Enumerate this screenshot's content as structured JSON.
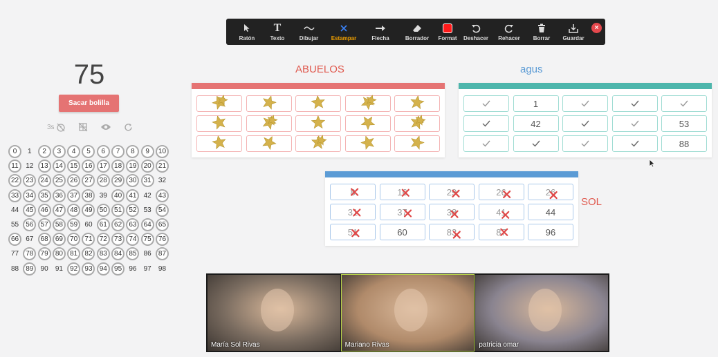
{
  "toolbar": {
    "tools": [
      {
        "label": "Ratón",
        "icon": "mouse-pointer-icon"
      },
      {
        "label": "Texto",
        "icon": "text-icon"
      },
      {
        "label": "Dibujar",
        "icon": "draw-squiggle-icon"
      },
      {
        "label": "Estampar",
        "icon": "stamp-x-icon",
        "active": true
      },
      {
        "label": "Flecha",
        "icon": "arrow-icon"
      },
      {
        "label": "Borrador",
        "icon": "eraser-icon"
      },
      {
        "label": "Format",
        "icon": "color-swatch-icon"
      },
      {
        "label": "Deshacer",
        "icon": "undo-icon"
      },
      {
        "label": "Rehacer",
        "icon": "redo-icon"
      },
      {
        "label": "Borrar",
        "icon": "trash-icon"
      },
      {
        "label": "Guardar",
        "icon": "save-icon"
      }
    ],
    "close_symbol": "×"
  },
  "bingo": {
    "current_number": "75",
    "draw_button": "Sacar bolilla",
    "timer_label": "3s",
    "numbers": [
      {
        "n": "0",
        "c": true
      },
      {
        "n": "1",
        "c": false
      },
      {
        "n": "2",
        "c": true
      },
      {
        "n": "3",
        "c": true
      },
      {
        "n": "4",
        "c": true
      },
      {
        "n": "5",
        "c": true
      },
      {
        "n": "6",
        "c": true
      },
      {
        "n": "7",
        "c": true
      },
      {
        "n": "8",
        "c": true
      },
      {
        "n": "9",
        "c": true
      },
      {
        "n": "10",
        "c": true
      },
      {
        "n": "11",
        "c": true
      },
      {
        "n": "12",
        "c": false
      },
      {
        "n": "13",
        "c": true
      },
      {
        "n": "14",
        "c": true
      },
      {
        "n": "15",
        "c": true
      },
      {
        "n": "16",
        "c": true
      },
      {
        "n": "17",
        "c": true
      },
      {
        "n": "18",
        "c": true
      },
      {
        "n": "19",
        "c": true
      },
      {
        "n": "20",
        "c": true
      },
      {
        "n": "21",
        "c": true
      },
      {
        "n": "22",
        "c": true
      },
      {
        "n": "23",
        "c": true
      },
      {
        "n": "24",
        "c": true
      },
      {
        "n": "25",
        "c": true
      },
      {
        "n": "26",
        "c": true
      },
      {
        "n": "27",
        "c": true
      },
      {
        "n": "28",
        "c": true
      },
      {
        "n": "29",
        "c": true
      },
      {
        "n": "30",
        "c": true
      },
      {
        "n": "31",
        "c": true
      },
      {
        "n": "32",
        "c": false
      },
      {
        "n": "33",
        "c": true
      },
      {
        "n": "34",
        "c": true
      },
      {
        "n": "35",
        "c": true
      },
      {
        "n": "36",
        "c": true
      },
      {
        "n": "37",
        "c": true
      },
      {
        "n": "38",
        "c": true
      },
      {
        "n": "39",
        "c": false
      },
      {
        "n": "40",
        "c": true
      },
      {
        "n": "41",
        "c": true
      },
      {
        "n": "42",
        "c": false
      },
      {
        "n": "43",
        "c": true
      },
      {
        "n": "44",
        "c": false
      },
      {
        "n": "45",
        "c": true
      },
      {
        "n": "46",
        "c": true
      },
      {
        "n": "47",
        "c": true
      },
      {
        "n": "48",
        "c": true
      },
      {
        "n": "49",
        "c": true
      },
      {
        "n": "50",
        "c": true
      },
      {
        "n": "51",
        "c": true
      },
      {
        "n": "52",
        "c": true
      },
      {
        "n": "53",
        "c": false
      },
      {
        "n": "54",
        "c": true
      },
      {
        "n": "55",
        "c": false
      },
      {
        "n": "56",
        "c": true
      },
      {
        "n": "57",
        "c": true
      },
      {
        "n": "58",
        "c": true
      },
      {
        "n": "59",
        "c": true
      },
      {
        "n": "60",
        "c": false
      },
      {
        "n": "61",
        "c": true
      },
      {
        "n": "62",
        "c": true
      },
      {
        "n": "63",
        "c": true
      },
      {
        "n": "64",
        "c": true
      },
      {
        "n": "65",
        "c": true
      },
      {
        "n": "66",
        "c": true
      },
      {
        "n": "67",
        "c": false
      },
      {
        "n": "68",
        "c": true
      },
      {
        "n": "69",
        "c": true
      },
      {
        "n": "70",
        "c": true
      },
      {
        "n": "71",
        "c": true
      },
      {
        "n": "72",
        "c": true
      },
      {
        "n": "73",
        "c": true
      },
      {
        "n": "74",
        "c": true
      },
      {
        "n": "75",
        "c": true
      },
      {
        "n": "76",
        "c": true
      },
      {
        "n": "77",
        "c": false
      },
      {
        "n": "78",
        "c": true
      },
      {
        "n": "79",
        "c": true
      },
      {
        "n": "80",
        "c": true
      },
      {
        "n": "81",
        "c": true
      },
      {
        "n": "82",
        "c": true
      },
      {
        "n": "83",
        "c": true
      },
      {
        "n": "84",
        "c": true
      },
      {
        "n": "85",
        "c": true
      },
      {
        "n": "86",
        "c": false
      },
      {
        "n": "87",
        "c": true
      },
      {
        "n": "88",
        "c": false
      },
      {
        "n": "89",
        "c": true
      },
      {
        "n": "90",
        "c": false
      },
      {
        "n": "91",
        "c": false
      },
      {
        "n": "92",
        "c": true
      },
      {
        "n": "93",
        "c": true
      },
      {
        "n": "94",
        "c": true
      },
      {
        "n": "95",
        "c": true
      },
      {
        "n": "96",
        "c": false
      },
      {
        "n": "97",
        "c": false
      },
      {
        "n": "98",
        "c": false
      }
    ]
  },
  "cards": {
    "abuelos": {
      "title": "ABUELOS",
      "title_color": "#e05a4f",
      "bar_color": "#e57373",
      "border_color": "#f4b4b4",
      "cells": [
        "",
        "",
        "",
        "",
        "",
        "",
        "",
        "",
        "",
        "",
        "",
        "",
        "",
        "",
        "",
        "",
        "",
        "",
        "",
        "",
        "",
        "",
        "",
        "",
        "",
        "",
        "",
        "",
        "",
        ""
      ]
    },
    "agus": {
      "title": "agus",
      "title_color": "#5b9bd5",
      "bar_color": "#4db6ac",
      "border_color": "#9fdcd3",
      "cells": [
        "",
        "1",
        "",
        "",
        "",
        "",
        "42",
        "",
        "",
        "53",
        "",
        "",
        "",
        "",
        "88"
      ]
    },
    "sol": {
      "title": "SOL",
      "title_color": "#e05a4f",
      "bar_color": "#5b9bd5",
      "border_color": "#a9c8ea",
      "cells": [
        "8",
        "16",
        "29",
        "26",
        "26",
        "31",
        "37",
        "38",
        "41",
        "44",
        "51",
        "60",
        "83",
        "87",
        "96"
      ],
      "crossed": [
        true,
        true,
        true,
        true,
        true,
        true,
        true,
        true,
        true,
        false,
        true,
        false,
        true,
        true,
        false
      ]
    }
  },
  "participants": [
    {
      "name": "María Sol Rivas",
      "bg": "#7a6c60"
    },
    {
      "name": "Mariano Rivas",
      "bg": "#b08a6a",
      "active": true
    },
    {
      "name": "patricia omar",
      "bg": "#8a8490"
    }
  ]
}
